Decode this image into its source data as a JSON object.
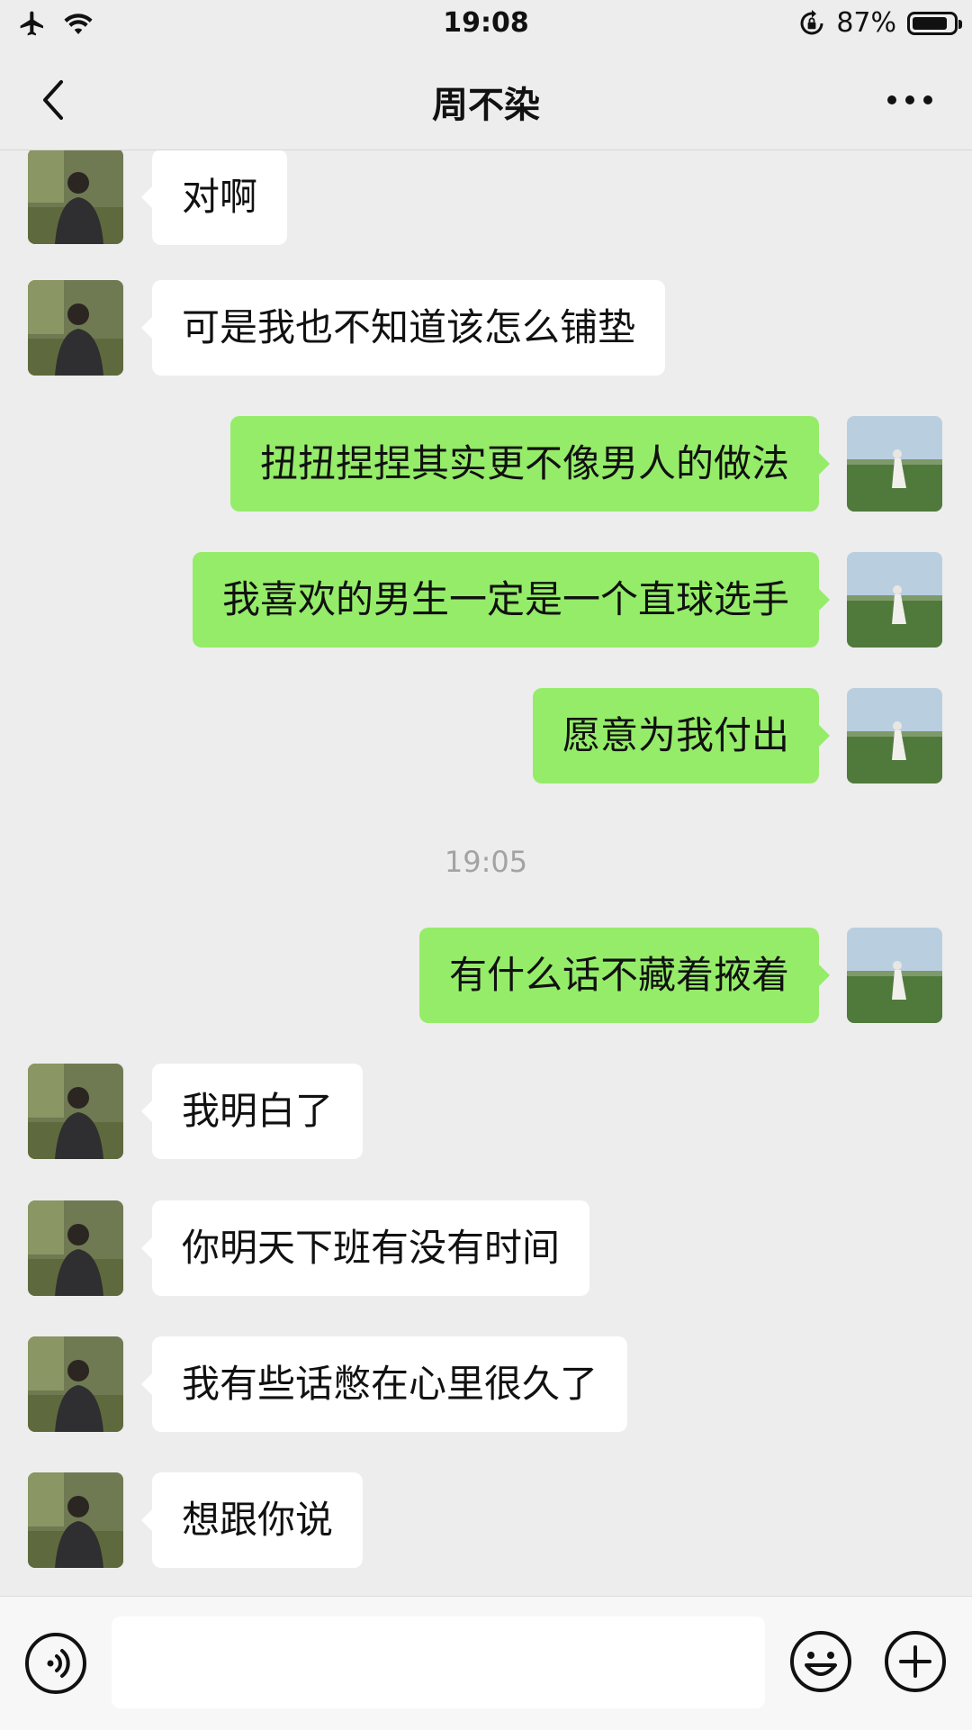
{
  "status_bar": {
    "time": "19:08",
    "battery_text": "87%",
    "battery_level": 0.87,
    "icons": [
      "airplane-icon",
      "wifi-icon",
      "rotation-lock-icon",
      "battery-icon"
    ]
  },
  "nav": {
    "title": "周不染",
    "icons": [
      "back-chevron-icon",
      "more-dots-icon"
    ]
  },
  "messages": [
    {
      "side": "recv",
      "text": "对啊"
    },
    {
      "side": "recv",
      "text": "可是我也不知道该怎么铺垫"
    },
    {
      "side": "sent",
      "text": "扭扭捏捏其实更不像男人的做法"
    },
    {
      "side": "sent",
      "text": "我喜欢的男生一定是一个直球选手"
    },
    {
      "side": "sent",
      "text": "愿意为我付出"
    },
    {
      "timestamp": "19:05"
    },
    {
      "side": "sent",
      "text": "有什么话不藏着掖着"
    },
    {
      "side": "recv",
      "text": "我明白了"
    },
    {
      "side": "recv",
      "text": "你明天下班有没有时间"
    },
    {
      "side": "recv",
      "text": "我有些话憋在心里很久了"
    },
    {
      "side": "recv",
      "text": "想跟你说"
    }
  ],
  "input_bar": {
    "value": "",
    "icons": [
      "voice-icon",
      "emoji-icon",
      "plus-icon"
    ]
  },
  "colors": {
    "background": "#ededed",
    "sent_bubble": "#95ec69",
    "recv_bubble": "#ffffff",
    "timestamp": "#a3a3a3"
  }
}
